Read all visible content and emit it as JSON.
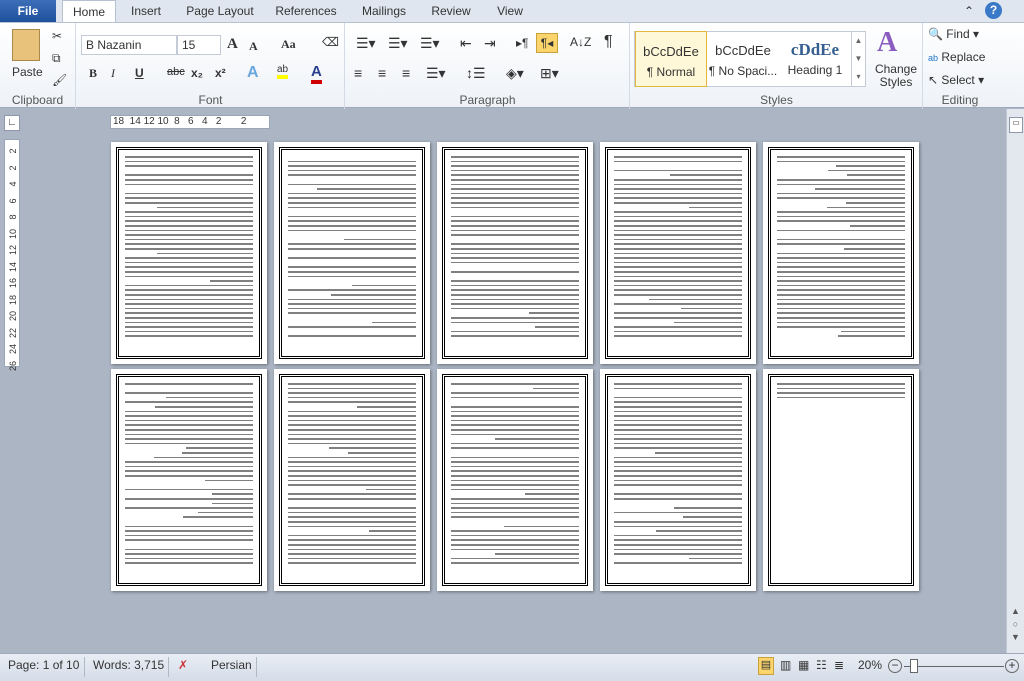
{
  "tabs": [
    "File",
    "Home",
    "Insert",
    "Page Layout",
    "References",
    "Mailings",
    "Review",
    "View"
  ],
  "clipboard": {
    "paste": "Paste",
    "label": "Clipboard"
  },
  "font": {
    "name": "B Nazanin",
    "size": "15",
    "label": "Font",
    "bold": "B",
    "italic": "I",
    "underline": "U",
    "strike": "abc",
    "sub": "x₂",
    "sup": "x²",
    "aa": "Aa",
    "grow": "A",
    "shrink": "A",
    "color_highlight": "#ffff00",
    "color_font": "#d00000"
  },
  "paragraph": {
    "label": "Paragraph",
    "pilcrow": "¶",
    "sort": "A↓Z"
  },
  "styles": {
    "label": "Styles",
    "items": [
      {
        "preview": "bCcDdEe",
        "name": "¶ Normal"
      },
      {
        "preview": "bCcDdEe",
        "name": "¶ No Spaci..."
      },
      {
        "preview": "cDdEe",
        "name": "Heading 1"
      }
    ],
    "change": "Change Styles"
  },
  "editing": {
    "label": "Editing",
    "find": "Find",
    "replace": "Replace",
    "select": "Select"
  },
  "ruler": {
    "h": "18  14 12 10  8   6   4   2       2",
    "v": [
      "2",
      "2",
      "4",
      "6",
      "8",
      "10",
      "12",
      "14",
      "16",
      "18",
      "20",
      "22",
      "24",
      "26"
    ]
  },
  "status": {
    "page": "Page: 1 of 10",
    "words": "Words: 3,715",
    "language": "Persian",
    "zoom": "20%"
  }
}
